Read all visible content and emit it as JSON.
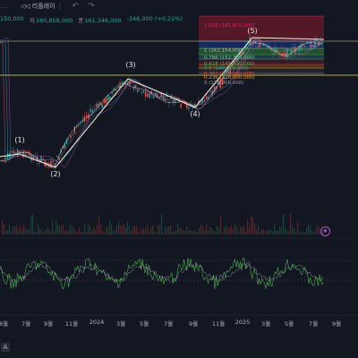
{
  "toolbar": {
    "replay_label": "리플레이",
    "undo_icon": "undo-icon",
    "redo_icon": "redo-icon"
  },
  "ohlc": {
    "open_value": "150,000",
    "close_key": "저",
    "close_value": "160,858,000",
    "last_key": "종",
    "last_value": "161,346,000",
    "change": "-346,000 (+0.22%)"
  },
  "waves": [
    "(1)",
    "(2)",
    "(3)",
    "(4)",
    "(5)"
  ],
  "fib_levels": [
    {
      "label": "1.618 (195,472,000)",
      "color": "#e91e63"
    },
    {
      "label": "1 (162,154,000)",
      "color": "#b2b5be"
    },
    {
      "label": "0.786 (152,300,000)",
      "color": "#81c784"
    },
    {
      "label": "0.618 (145,000,000)",
      "color": "#4caf50"
    },
    {
      "label": "0.5 (140,000,000)",
      "color": "#26a69a"
    },
    {
      "label": "0.382 (134,000,000)",
      "color": "#f44336"
    },
    {
      "label": "0.236 (128,000,000)",
      "color": "#ff9800"
    },
    {
      "label": "0 (118,000,000)",
      "color": "#9e9e9e"
    }
  ],
  "x_axis": [
    "8월",
    "7월",
    "9월",
    "11월",
    "2024",
    "3월",
    "5월",
    "7월",
    "9월",
    "11월",
    "2025",
    "3월",
    "5월",
    "7월",
    "9월"
  ],
  "colors": {
    "background": "#131722",
    "candle_up": "#26a69a",
    "candle_down": "#ef5350",
    "wave_line": "#f5f5dc",
    "horizontal_line": "#f0e040",
    "oscillator": "#4caf50"
  },
  "bottom": {
    "badge": "A"
  }
}
